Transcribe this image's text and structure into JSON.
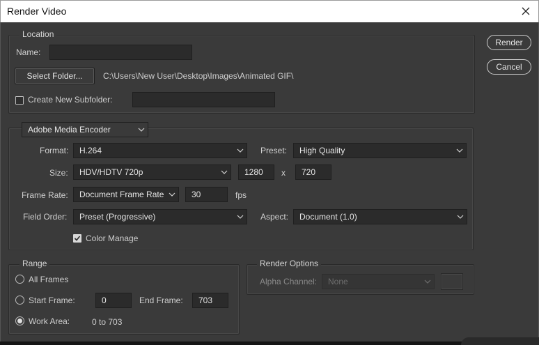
{
  "window": {
    "title": "Render Video",
    "icons": {
      "close": "close-icon"
    }
  },
  "location": {
    "legend": "Location",
    "name_label": "Name:",
    "name_value": "",
    "select_folder_label": "Select Folder...",
    "folder_path": "C:\\Users\\New User\\Desktop\\Images\\Animated GIF\\",
    "create_subfolder_label": "Create New Subfolder:",
    "create_subfolder_checked": false,
    "subfolder_value": ""
  },
  "encoder": {
    "selected": "Adobe Media Encoder",
    "format_label": "Format:",
    "format_value": "H.264",
    "preset_label": "Preset:",
    "preset_value": "High Quality",
    "size_label": "Size:",
    "size_value": "HDV/HDTV 720p",
    "width": "1280",
    "size_x": "x",
    "height": "720",
    "frame_rate_label": "Frame Rate:",
    "frame_rate_value": "Document Frame Rate",
    "fps_value": "30",
    "fps_unit": "fps",
    "field_order_label": "Field Order:",
    "field_order_value": "Preset (Progressive)",
    "aspect_label": "Aspect:",
    "aspect_value": "Document (1.0)",
    "color_manage_label": "Color Manage",
    "color_manage_checked": true
  },
  "range": {
    "legend": "Range",
    "all_frames_label": "All Frames",
    "start_frame_label": "Start Frame:",
    "start_frame_value": "0",
    "end_frame_label": "End Frame:",
    "end_frame_value": "703",
    "work_area_label": "Work Area:",
    "work_area_value": "0 to 703",
    "selected": "work_area"
  },
  "render_options": {
    "legend": "Render Options",
    "alpha_label": "Alpha Channel:",
    "alpha_value": "None"
  },
  "actions": {
    "render_label": "Render",
    "cancel_label": "Cancel"
  },
  "colors": {
    "dialog_bg": "#3a3a3a",
    "field_bg": "#2b2b2b",
    "text": "#d6d6d6"
  }
}
